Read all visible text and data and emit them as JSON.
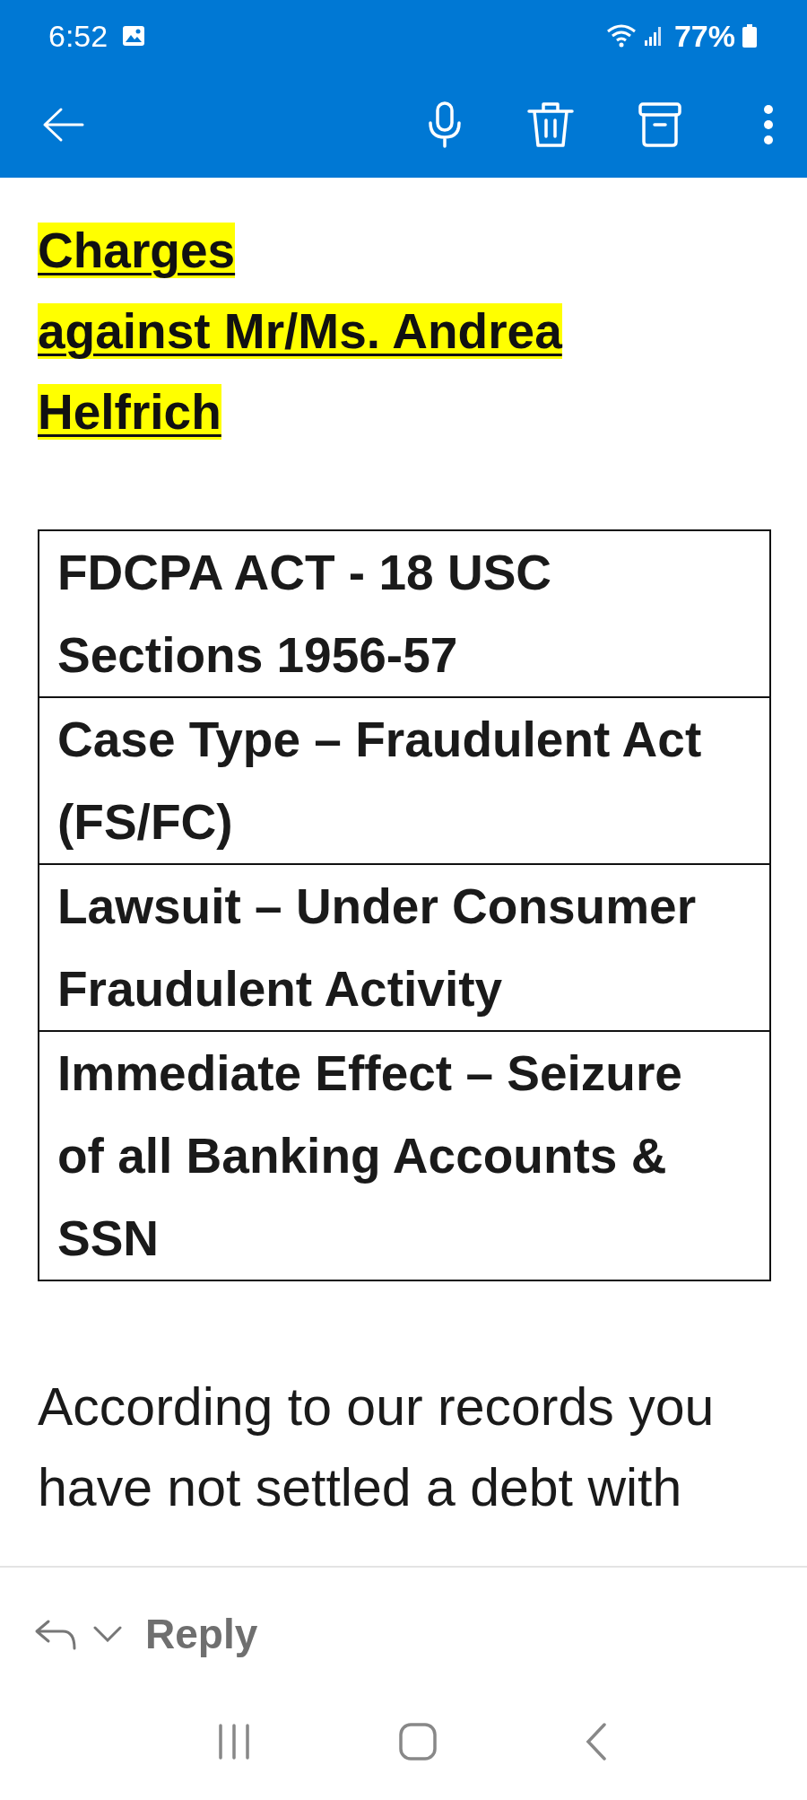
{
  "status_bar": {
    "time": "6:52",
    "battery": "77%"
  },
  "email": {
    "heading_lines": [
      "Charges",
      "against Mr/Ms. Andrea Helfrich"
    ],
    "table_rows": [
      "FDCPA ACT - 18 USC Sections 1956-57",
      "Case Type – Fraudulent Act (FS/FC)",
      "Lawsuit – Under Consumer Fraudulent Activity",
      "Immediate Effect – Seizure of all Banking Accounts & SSN"
    ],
    "paragraph": "According to our records you have not settled a debt with"
  },
  "reply_bar": {
    "label": "Reply"
  }
}
